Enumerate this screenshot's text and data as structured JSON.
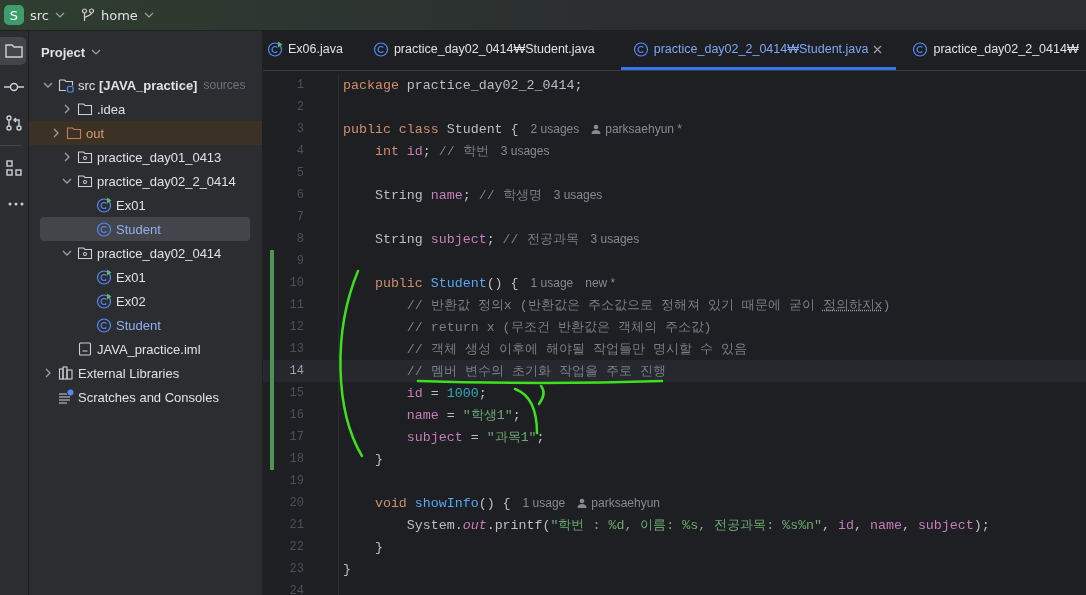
{
  "titlebar": {
    "project_badge": "S",
    "project": "src",
    "branch": "home"
  },
  "toolstrip": [
    {
      "kind": "project",
      "selected": true
    },
    {
      "kind": "commit",
      "selected": false
    },
    {
      "kind": "pull-requests",
      "selected": false
    },
    {
      "kind": "structure",
      "selected": false
    },
    {
      "kind": "more",
      "selected": false
    }
  ],
  "sidebar": {
    "title": "Project",
    "tree": [
      {
        "label": "src **[JAVA_practice]**",
        "note": "sources",
        "kind": "source-root",
        "expanded": true,
        "selected": false,
        "children": [
          {
            "label": ".idea",
            "kind": "folder",
            "expanded": false,
            "selected": false
          },
          {
            "label": "out",
            "kind": "excluded-folder",
            "expanded": false,
            "selected": false
          },
          {
            "label": "practice_day01_0413",
            "kind": "package",
            "expanded": false,
            "selected": false
          },
          {
            "label": "practice_day02_2_0414",
            "kind": "package",
            "expanded": true,
            "selected": false,
            "children": [
              {
                "label": "Ex01",
                "kind": "runnable-class",
                "selected": false
              },
              {
                "label": "Student",
                "kind": "class",
                "selected": true
              }
            ]
          },
          {
            "label": "practice_day02_0414",
            "kind": "package",
            "expanded": true,
            "selected": false,
            "children": [
              {
                "label": "Ex01",
                "kind": "runnable-class",
                "selected": false
              },
              {
                "label": "Ex02",
                "kind": "runnable-class",
                "selected": false
              },
              {
                "label": "Student",
                "kind": "class",
                "selected": false
              }
            ]
          },
          {
            "label": "JAVA_practice.iml",
            "kind": "file",
            "selected": false
          }
        ]
      },
      {
        "label": "External Libraries",
        "kind": "libraries",
        "expanded": false,
        "selected": false
      },
      {
        "label": "Scratches and Consoles",
        "kind": "scratches",
        "selected": false
      }
    ]
  },
  "tabs": [
    {
      "label": "Ex06.java",
      "kind": "runnable-class",
      "selected": false
    },
    {
      "label": "practice_day02_0414₩Student.java",
      "kind": "class",
      "selected": false
    },
    {
      "label": "practice_day02_2_0414₩Student.java",
      "kind": "class",
      "selected": true
    },
    {
      "label": "practice_day02_2_0414₩",
      "kind": "class",
      "selected": false
    }
  ],
  "code": [
    {
      "n": "1",
      "changed": false,
      "current": false,
      "tokens": [
        {
          "text": "package ",
          "kind": "keyword"
        },
        {
          "text": "practice_day02_2_0414;",
          "kind": "plain"
        }
      ]
    },
    {
      "n": "2",
      "changed": false,
      "current": false
    },
    {
      "n": "3",
      "changed": false,
      "current": false,
      "tokens": [
        {
          "text": "public class ",
          "kind": "keyword"
        },
        {
          "text": "Student {",
          "kind": "plain"
        }
      ],
      "hints": [
        {
          "text": "2 usages",
          "kind": "usage"
        },
        {
          "text": "parksaehyun *",
          "kind": "author"
        }
      ]
    },
    {
      "n": "4",
      "changed": false,
      "current": false,
      "tokens": [
        {
          "text": "    int ",
          "kind": "keyword"
        },
        {
          "text": "id",
          "kind": "field"
        },
        {
          "text": "; ",
          "kind": "plain"
        },
        {
          "text": "// 학번",
          "kind": "comment"
        }
      ],
      "hints": [
        {
          "text": "3 usages",
          "kind": "usage"
        }
      ]
    },
    {
      "n": "5",
      "changed": false,
      "current": false
    },
    {
      "n": "6",
      "changed": false,
      "current": false,
      "tokens": [
        {
          "text": "    String ",
          "kind": "plain"
        },
        {
          "text": "name",
          "kind": "field"
        },
        {
          "text": "; ",
          "kind": "plain"
        },
        {
          "text": "// 학생명",
          "kind": "comment"
        }
      ],
      "hints": [
        {
          "text": "3 usages",
          "kind": "usage"
        }
      ]
    },
    {
      "n": "7",
      "changed": false,
      "current": false
    },
    {
      "n": "8",
      "changed": false,
      "current": false,
      "tokens": [
        {
          "text": "    String ",
          "kind": "plain"
        },
        {
          "text": "subject",
          "kind": "field"
        },
        {
          "text": "; ",
          "kind": "plain"
        },
        {
          "text": "// 전공과목",
          "kind": "comment"
        }
      ],
      "hints": [
        {
          "text": "3 usages",
          "kind": "usage"
        }
      ]
    },
    {
      "n": "9",
      "changed": true,
      "current": false
    },
    {
      "n": "10",
      "changed": true,
      "current": false,
      "tokens": [
        {
          "text": "    public ",
          "kind": "keyword"
        },
        {
          "text": "Student",
          "kind": "method"
        },
        {
          "text": "() {",
          "kind": "plain"
        }
      ],
      "hints": [
        {
          "text": "1 usage",
          "kind": "usage"
        },
        {
          "text": "new *",
          "kind": "usage"
        }
      ]
    },
    {
      "n": "11",
      "changed": true,
      "current": false,
      "tokens": [
        {
          "text": "        // 반환값 정의x (반환값은 주소값으로 정해져 있기 때문에 굳이 ",
          "kind": "comment"
        },
        {
          "text": "정의하지x",
          "kind": "typo"
        },
        {
          "text": ")",
          "kind": "comment"
        }
      ]
    },
    {
      "n": "12",
      "changed": true,
      "current": false,
      "tokens": [
        {
          "text": "        // return x (무조건 반환값은 객체의 주소값)",
          "kind": "comment"
        }
      ]
    },
    {
      "n": "13",
      "changed": true,
      "current": false,
      "tokens": [
        {
          "text": "        // 객체 생성 이후에 해야될 작업들만 명시할 수 있음",
          "kind": "comment"
        }
      ]
    },
    {
      "n": "14",
      "changed": true,
      "current": true,
      "tokens": [
        {
          "text": "        // 멤버 변수의 초기화 작업을 주로 진행",
          "kind": "comment"
        }
      ]
    },
    {
      "n": "15",
      "changed": true,
      "current": false,
      "tokens": [
        {
          "text": "        id",
          "kind": "field"
        },
        {
          "text": " = ",
          "kind": "plain"
        },
        {
          "text": "1000",
          "kind": "number"
        },
        {
          "text": ";",
          "kind": "plain"
        }
      ]
    },
    {
      "n": "16",
      "changed": true,
      "current": false,
      "tokens": [
        {
          "text": "        name",
          "kind": "field"
        },
        {
          "text": " = ",
          "kind": "plain"
        },
        {
          "text": "\"학생1\"",
          "kind": "string"
        },
        {
          "text": ";",
          "kind": "plain"
        }
      ]
    },
    {
      "n": "17",
      "changed": true,
      "current": false,
      "tokens": [
        {
          "text": "        subject",
          "kind": "field"
        },
        {
          "text": " = ",
          "kind": "plain"
        },
        {
          "text": "\"과목1\"",
          "kind": "string"
        },
        {
          "text": ";",
          "kind": "plain"
        }
      ]
    },
    {
      "n": "18",
      "changed": true,
      "current": false,
      "tokens": [
        {
          "text": "    }",
          "kind": "plain"
        }
      ]
    },
    {
      "n": "19",
      "changed": false,
      "current": false
    },
    {
      "n": "20",
      "changed": false,
      "current": false,
      "tokens": [
        {
          "text": "    void ",
          "kind": "keyword"
        },
        {
          "text": "showInfo",
          "kind": "method"
        },
        {
          "text": "() {",
          "kind": "plain"
        }
      ],
      "hints": [
        {
          "text": "1 usage",
          "kind": "usage"
        },
        {
          "text": "parksaehyun",
          "kind": "author"
        }
      ]
    },
    {
      "n": "21",
      "changed": false,
      "current": false,
      "tokens": [
        {
          "text": "        System.",
          "kind": "plain"
        },
        {
          "text": "out",
          "kind": "static"
        },
        {
          "text": ".printf(",
          "kind": "plain"
        },
        {
          "text": "\"학번 : %d, 이름: %s, 전공과목: %s%n\"",
          "kind": "string"
        },
        {
          "text": ", ",
          "kind": "plain"
        },
        {
          "text": "id",
          "kind": "field"
        },
        {
          "text": ", ",
          "kind": "plain"
        },
        {
          "text": "name",
          "kind": "field"
        },
        {
          "text": ", ",
          "kind": "plain"
        },
        {
          "text": "subject",
          "kind": "field"
        },
        {
          "text": ");",
          "kind": "plain"
        }
      ]
    },
    {
      "n": "22",
      "changed": false,
      "current": false,
      "tokens": [
        {
          "text": "    }",
          "kind": "plain"
        }
      ]
    },
    {
      "n": "23",
      "changed": false,
      "current": false,
      "tokens": [
        {
          "text": "}",
          "kind": "plain"
        }
      ]
    },
    {
      "n": "24",
      "changed": false,
      "current": false
    }
  ]
}
